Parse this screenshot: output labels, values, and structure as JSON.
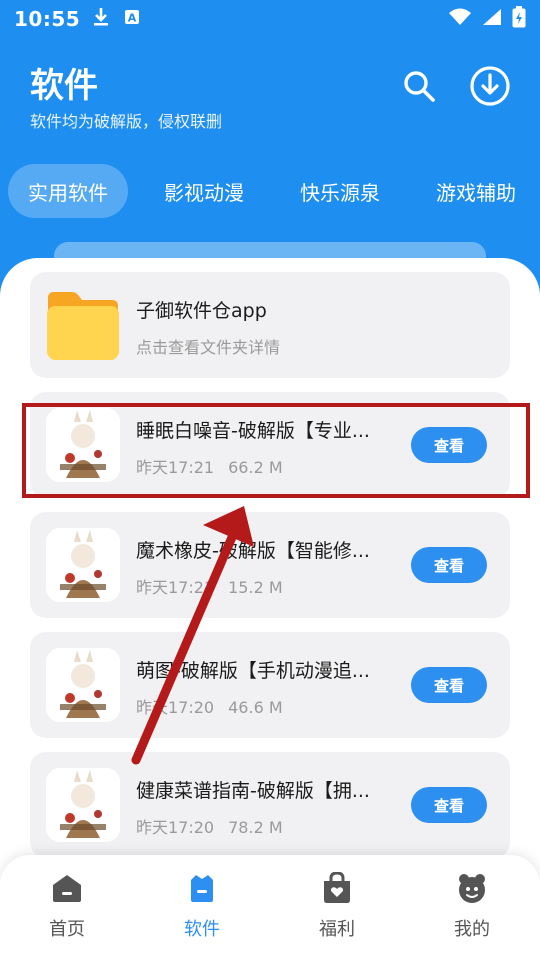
{
  "status_bar": {
    "time": "10:55",
    "left_icons": [
      "download-icon",
      "a-icon"
    ],
    "right_icons": [
      "wifi-icon",
      "signal-icon",
      "battery-icon"
    ]
  },
  "header": {
    "title": "软件",
    "subtitle": "软件均为破解版，侵权联删",
    "icons": [
      "search-icon",
      "download-circle-icon"
    ]
  },
  "tabs": [
    {
      "label": "实用软件",
      "active": true
    },
    {
      "label": "影视动漫",
      "active": false
    },
    {
      "label": "快乐源泉",
      "active": false
    },
    {
      "label": "游戏辅助",
      "active": false
    }
  ],
  "list": {
    "folder": {
      "title": "子御软件仓app",
      "subtitle": "点击查看文件夹详情",
      "icon": "folder-icon"
    },
    "items": [
      {
        "title": "睡眠白噪音-破解版【专业...",
        "time": "昨天17:21",
        "size": "66.2 M",
        "button": "查看"
      },
      {
        "title": "魔术橡皮-破解版【智能修...",
        "time": "昨天17:21",
        "size": "15.2 M",
        "button": "查看"
      },
      {
        "title": "萌图-破解版【手机动漫追...",
        "time": "昨天17:20",
        "size": "46.6 M",
        "button": "查看"
      },
      {
        "title": "健康菜谱指南-破解版【拥...",
        "time": "昨天17:20",
        "size": "78.2 M",
        "button": "查看"
      }
    ]
  },
  "bottom_nav": [
    {
      "label": "首页",
      "icon": "home-icon",
      "active": false
    },
    {
      "label": "软件",
      "icon": "apps-icon",
      "active": true
    },
    {
      "label": "福利",
      "icon": "gift-bag-icon",
      "active": false
    },
    {
      "label": "我的",
      "icon": "profile-icon",
      "active": false
    }
  ],
  "colors": {
    "primary": "#1e8ef0",
    "button": "#2d8ff0",
    "card": "#f1f1f3",
    "annotation": "#b51a1a"
  }
}
